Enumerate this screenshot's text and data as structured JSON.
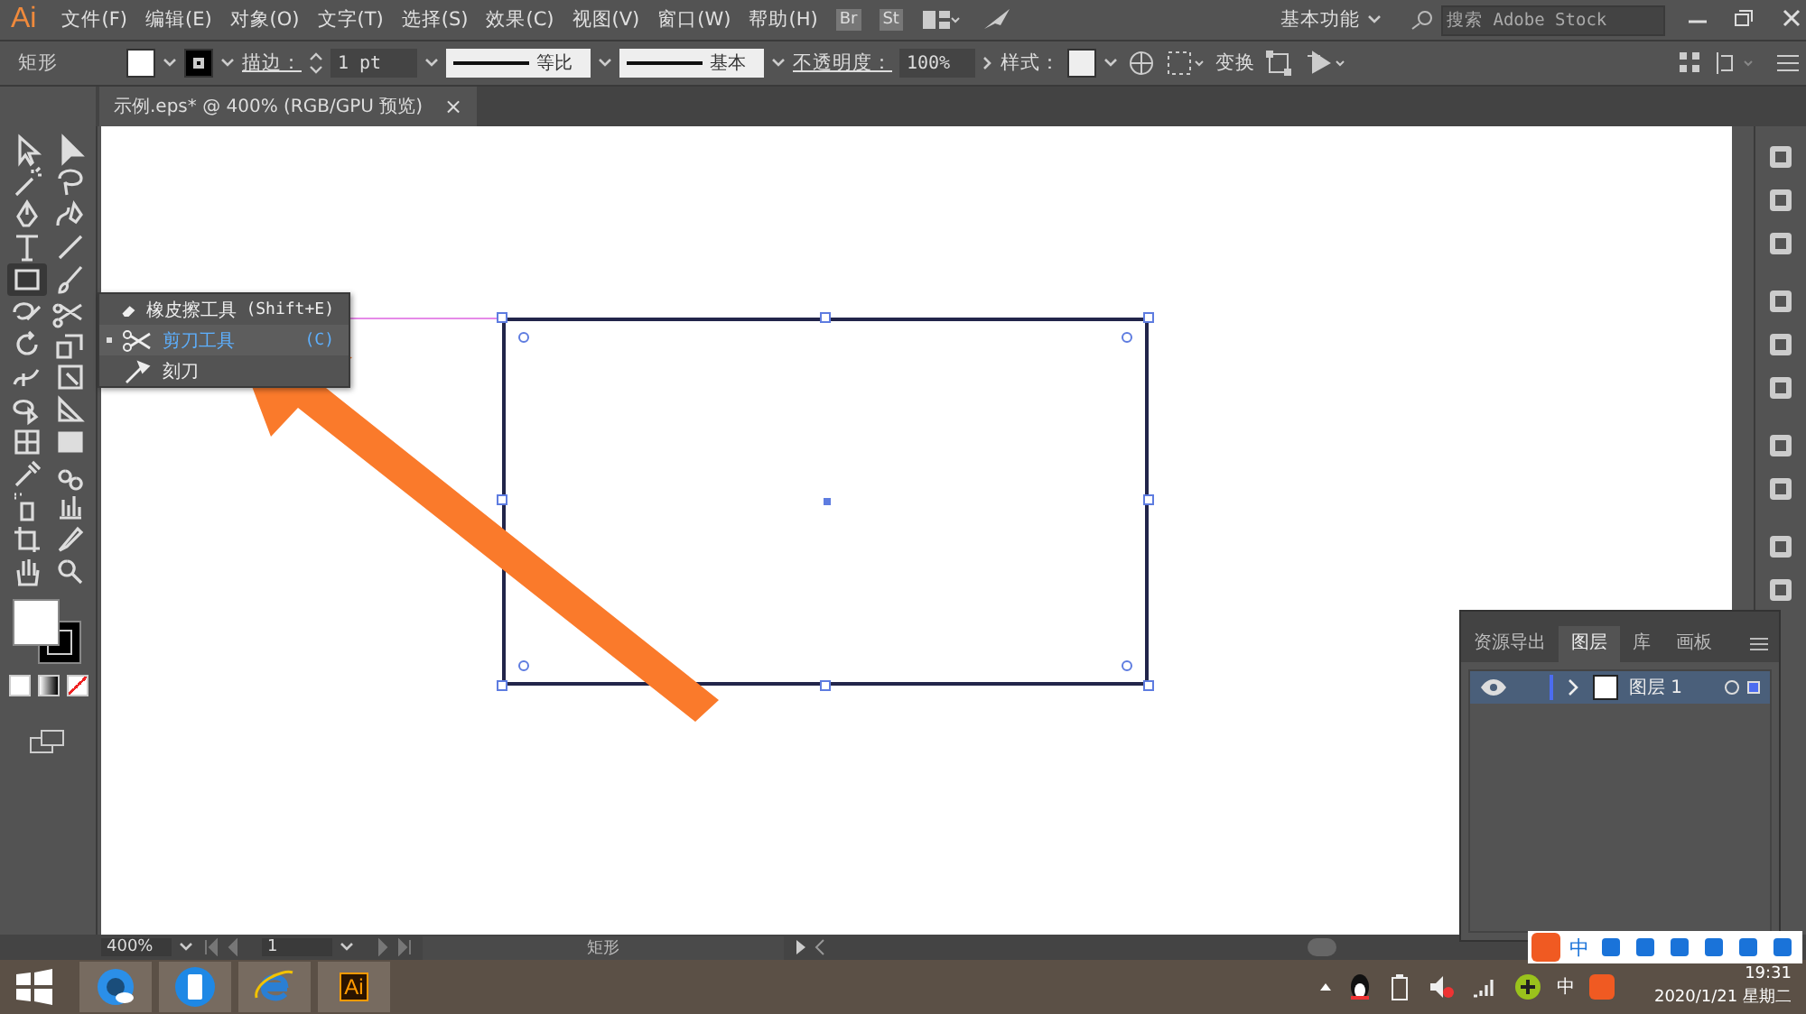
{
  "app": {
    "logo": "Ai"
  },
  "menu": [
    "文件(F)",
    "编辑(E)",
    "对象(O)",
    "文字(T)",
    "选择(S)",
    "效果(C)",
    "视图(V)",
    "窗口(W)",
    "帮助(H)"
  ],
  "bridge_buttons": [
    "Br",
    "St"
  ],
  "workspace": "基本功能",
  "search": {
    "placeholder": "搜索 Adobe Stock"
  },
  "control_bar": {
    "object": "矩形",
    "stroke_label": "描边：",
    "stroke_weight": "1 pt",
    "profile": "等比",
    "brush": "基本",
    "opacity_label": "不透明度：",
    "opacity": "100%",
    "style_label": "样式：",
    "transform": "变换"
  },
  "document_tab": {
    "title": "示例.eps* @ 400% (RGB/GPU 预览)",
    "close": "×"
  },
  "flyout": [
    {
      "label": "橡皮擦工具",
      "shortcut": "(Shift+E)",
      "selected": false
    },
    {
      "label": "剪刀工具",
      "shortcut": "(C)",
      "selected": true
    },
    {
      "label": "刻刀",
      "selected": false
    }
  ],
  "layers_panel": {
    "tabs": [
      {
        "label": "资源导出",
        "selected": false
      },
      {
        "label": "图层",
        "selected": true
      },
      {
        "label": "库",
        "selected": false
      },
      {
        "label": "画板",
        "selected": false
      }
    ],
    "layers": [
      {
        "name": "图层 1",
        "visible": true,
        "expanded": false
      }
    ]
  },
  "status_bar": {
    "zoom": "400%",
    "artboard": "1",
    "selection": "矩形"
  },
  "ime_bar": {
    "mode": "中"
  },
  "taskbar": {
    "app_icon": "Ai",
    "ime": "中",
    "time": "19:31",
    "date": "2020/1/21 星期二"
  }
}
